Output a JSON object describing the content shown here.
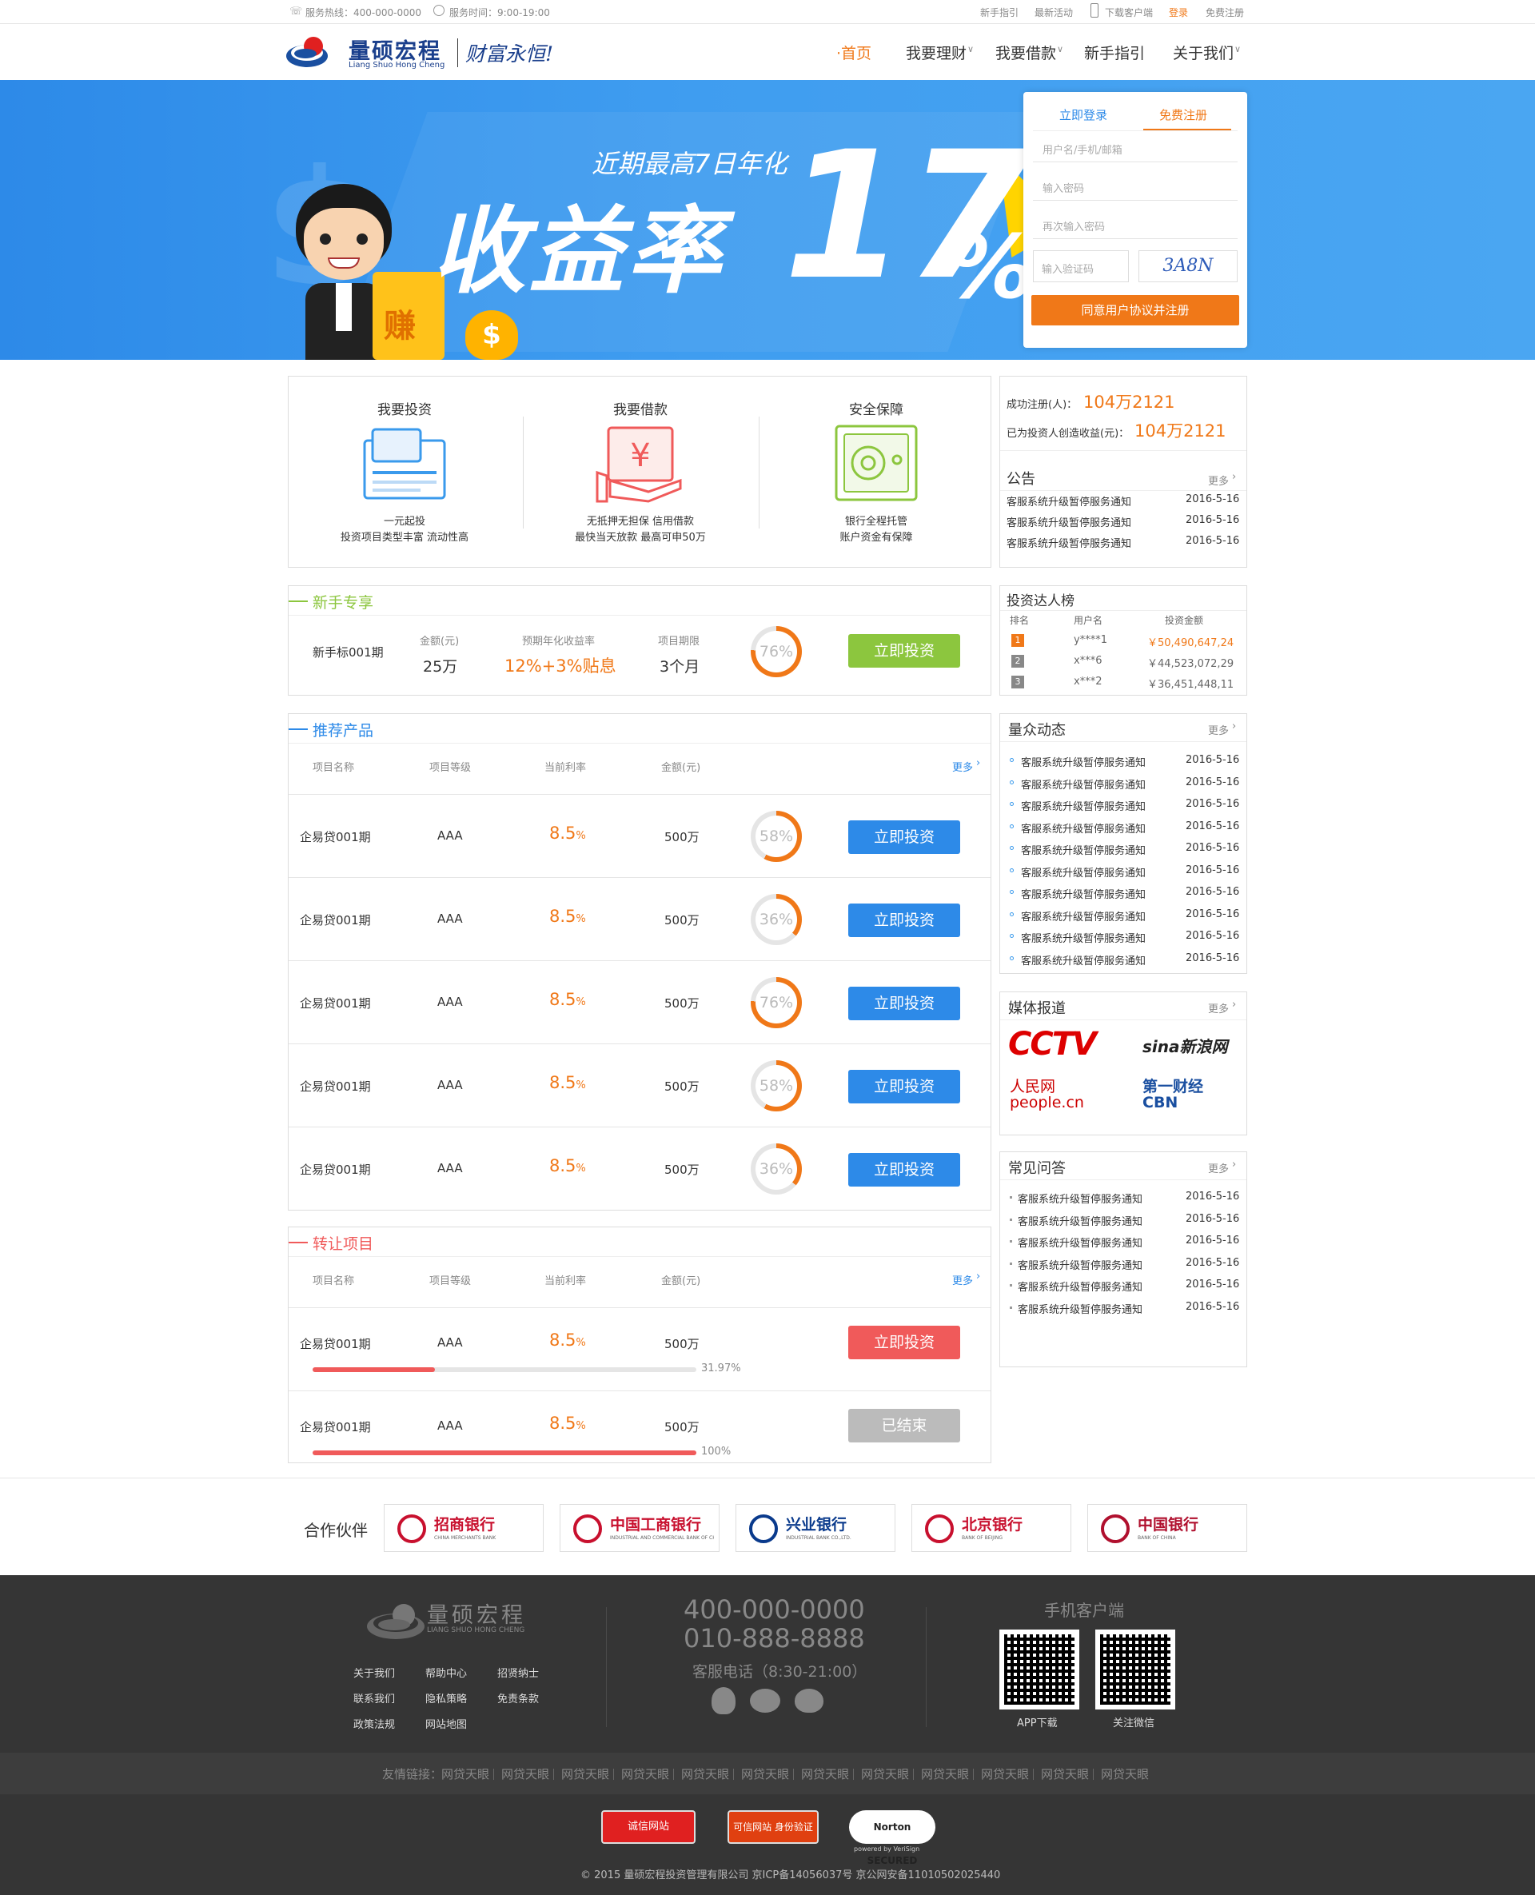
{
  "topbar": {
    "hotline": "服务热线：400-000-0000",
    "hours": "服务时间：9:00-19:00",
    "links": [
      "新手指引",
      "最新活动",
      "下载客户端",
      "登录",
      "免费注册"
    ]
  },
  "brand": {
    "name": "量硕宏程",
    "pinyin": "Liang Shuo Hong Cheng",
    "slogan": "财富永恒!"
  },
  "nav": [
    "·首页",
    "我要理财",
    "我要借款",
    "新手指引",
    "关于我们"
  ],
  "banner": {
    "line1": "近期最高7日年化",
    "line2": "收益率",
    "big": "17",
    "pct": "%",
    "coin": "赚"
  },
  "register": {
    "tab_login": "立即登录",
    "tab_register": "免费注册",
    "username": "用户名/手机/邮箱",
    "password": "输入密码",
    "password2": "再次输入密码",
    "captcha": "输入验证码",
    "captcha_img": "3A8N",
    "submit": "同意用户协议并注册"
  },
  "features": [
    {
      "title": "我要投资",
      "l1": "一元起投",
      "l2": "投资项目类型丰富  流动性高"
    },
    {
      "title": "我要借款",
      "l1": "无抵押无担保  信用借款",
      "l2": "最快当天放款  最高可申50万"
    },
    {
      "title": "安全保障",
      "l1": "银行全程托管",
      "l2": "账户资金有保障"
    }
  ],
  "stats": {
    "reg_label": "成功注册(人)：",
    "reg_val": "104万2121",
    "earn_label": "已为投资人创造收益(元)：",
    "earn_val": "104万2121"
  },
  "notice": {
    "title": "公告",
    "more": "更多",
    "items": [
      [
        "客服系统升级暂停服务通知",
        "2016-5-16"
      ],
      [
        "客服系统升级暂停服务通知",
        "2016-5-16"
      ],
      [
        "客服系统升级暂停服务通知",
        "2016-5-16"
      ]
    ]
  },
  "newbie": {
    "title": "新手专享",
    "name": "新手标001期",
    "amt_label": "金额(元)",
    "amt": "25万",
    "rate_label": "预期年化收益率",
    "rate": "12%+3%贴息",
    "term_label": "项目期限",
    "term": "3个月",
    "progress": "76%",
    "btn": "立即投资"
  },
  "ranking": {
    "title": "投资达人榜",
    "cols": [
      "排名",
      "用户名",
      "投资金额"
    ],
    "rows": [
      [
        "1",
        "y****1",
        "￥50,490,647,24"
      ],
      [
        "2",
        "x***6",
        "￥44,523,072,29"
      ],
      [
        "3",
        "x***2",
        "￥36,451,448,11"
      ]
    ]
  },
  "recommend": {
    "title": "推荐产品",
    "cols": [
      "项目名称",
      "项目等级",
      "当前利率",
      "金额(元)"
    ],
    "more": "更多",
    "rows": [
      {
        "name": "企易贷001期",
        "grade": "AAA",
        "rate": "8.5",
        "unit": "%",
        "amt": "500万",
        "progress": "58%",
        "pct": 58,
        "btn": "立即投资"
      },
      {
        "name": "企易贷001期",
        "grade": "AAA",
        "rate": "8.5",
        "unit": "%",
        "amt": "500万",
        "progress": "36%",
        "pct": 36,
        "btn": "立即投资"
      },
      {
        "name": "企易贷001期",
        "grade": "AAA",
        "rate": "8.5",
        "unit": "%",
        "amt": "500万",
        "progress": "76%",
        "pct": 76,
        "btn": "立即投资"
      },
      {
        "name": "企易贷001期",
        "grade": "AAA",
        "rate": "8.5",
        "unit": "%",
        "amt": "500万",
        "progress": "58%",
        "pct": 58,
        "btn": "立即投资"
      },
      {
        "name": "企易贷001期",
        "grade": "AAA",
        "rate": "8.5",
        "unit": "%",
        "amt": "500万",
        "progress": "36%",
        "pct": 36,
        "btn": "立即投资"
      }
    ]
  },
  "transfer": {
    "title": "转让项目",
    "cols": [
      "项目名称",
      "项目等级",
      "当前利率",
      "金额(元)"
    ],
    "more": "更多",
    "rows": [
      {
        "name": "企易贷001期",
        "grade": "AAA",
        "rate": "8.5",
        "unit": "%",
        "amt": "500万",
        "progress": "31.97%",
        "pct": 31.97,
        "btn": "立即投资"
      },
      {
        "name": "企易贷001期",
        "grade": "AAA",
        "rate": "8.5",
        "unit": "%",
        "amt": "500万",
        "progress": "100%",
        "pct": 100,
        "btn": "已结束"
      }
    ]
  },
  "dynamics": {
    "title": "量众动态",
    "more": "更多",
    "item": "客服系统升级暂停服务通知",
    "date": "2016-5-16"
  },
  "media": {
    "title": "媒体报道",
    "more": "更多",
    "logos": [
      "CCTV",
      "sina新浪网",
      "人民网 people.cn",
      "第一财经 CBN"
    ]
  },
  "faq": {
    "title": "常见问答",
    "more": "更多",
    "item": "客服系统升级暂停服务通知",
    "date": "2016-5-16"
  },
  "partners": {
    "title": "合作伙伴",
    "banks": [
      {
        "cn": "招商银行",
        "en": "CHINA MERCHANTS BANK",
        "color": "#c8102e"
      },
      {
        "cn": "中国工商银行",
        "en": "INDUSTRIAL AND COMMERCIAL BANK OF CHINA",
        "color": "#c8102e"
      },
      {
        "cn": "兴业银行",
        "en": "INDUSTRIAL BANK CO.,LTD.",
        "color": "#0a3a8c"
      },
      {
        "cn": "北京银行",
        "en": "BANK OF BEIJING",
        "color": "#c8102e"
      },
      {
        "cn": "中国银行",
        "en": "BANK OF CHINA",
        "color": "#b0102e"
      }
    ]
  },
  "footer": {
    "brand": "量硕宏程",
    "pinyin": "LIANG SHUO HONG CHENG",
    "links": [
      "关于我们",
      "帮助中心",
      "招贤纳士",
      "联系我们",
      "隐私策略",
      "免责条款",
      "政策法规",
      "网站地图"
    ],
    "phone1": "400-000-0000",
    "phone2": "010-888-8888",
    "service": "客服电话（8:30-21:00）",
    "app_title": "手机客户端",
    "qr1": "APP下载",
    "qr2": "关注微信",
    "friend_label": "友情链接：",
    "friend": "网贷天眼",
    "badges": [
      "诚信网站",
      "可信网站 身份验证",
      "Norton SECURED"
    ],
    "norton_sub": "powered by VeriSign",
    "copyright": "© 2015 量硕宏程投资管理有限公司 京ICP备14056037号 京公网安备11010502025440"
  },
  "colors": {
    "orange": "#f07818",
    "blue": "#2d8ae8",
    "green": "#8cc63e",
    "red": "#f05a5a",
    "gray": "#bbbbbb"
  }
}
